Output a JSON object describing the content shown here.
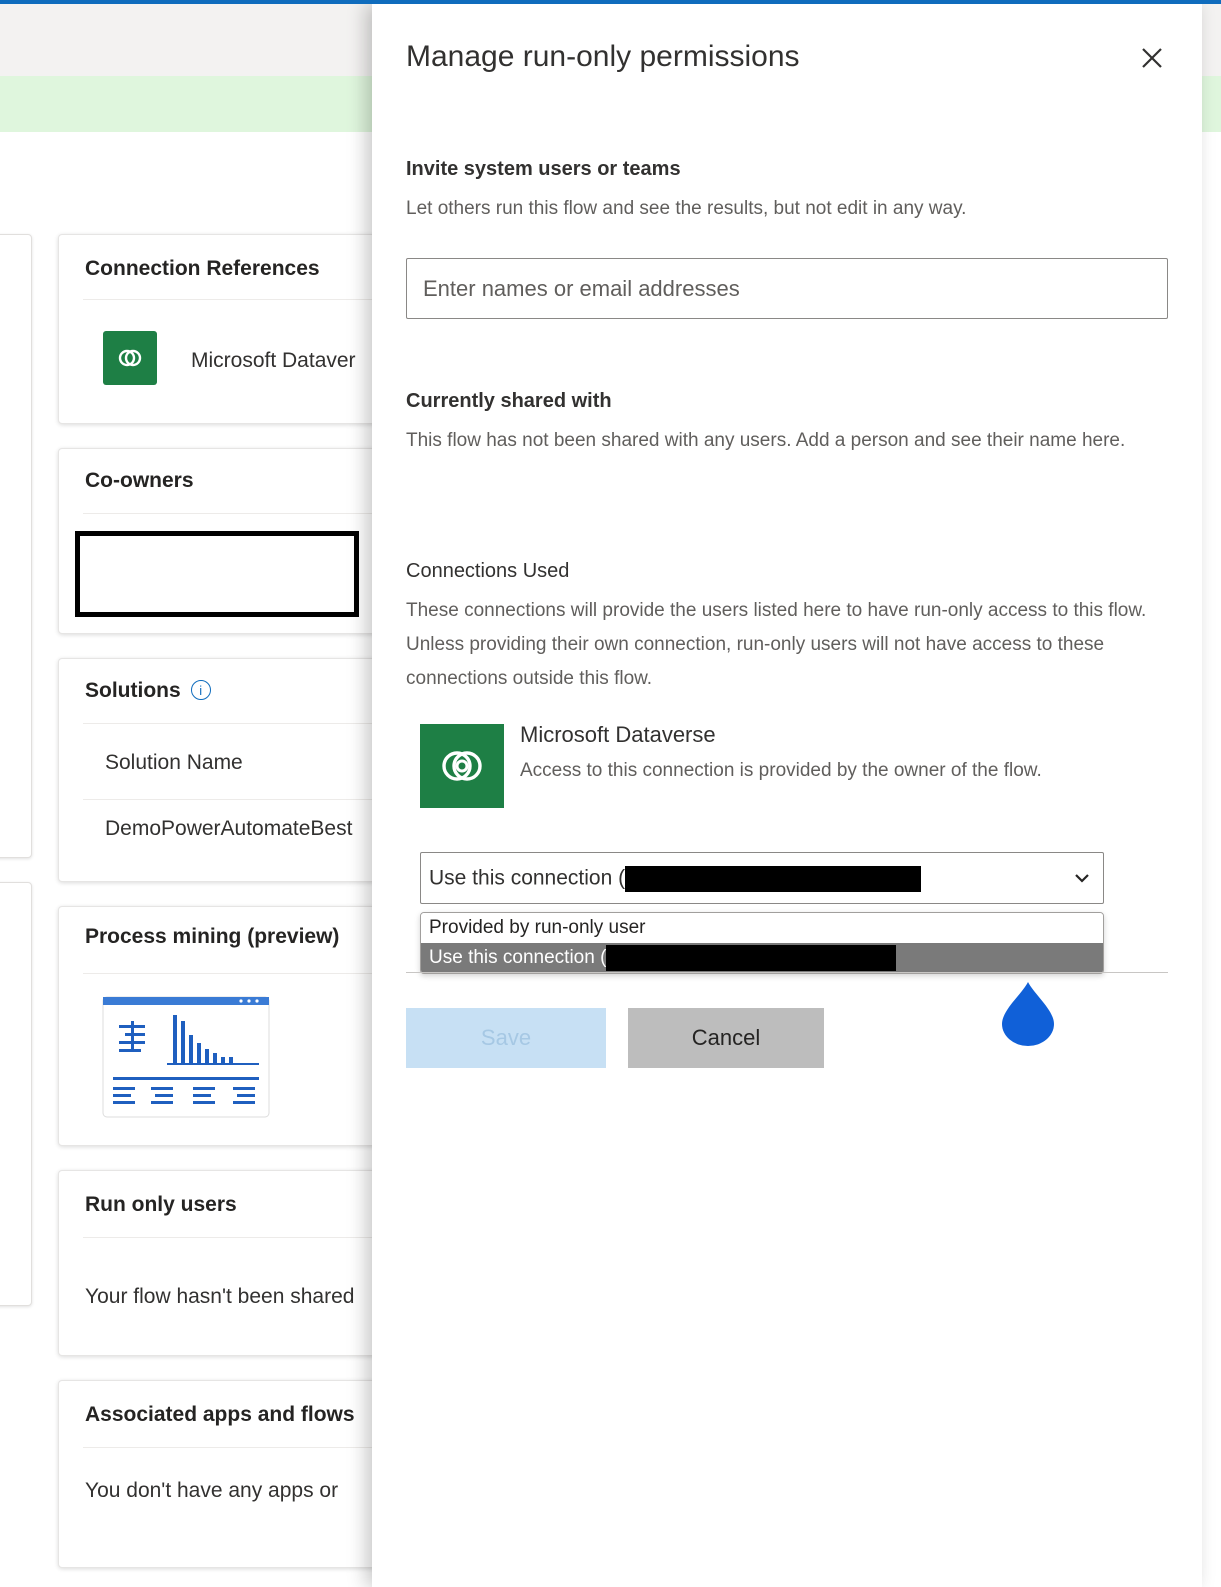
{
  "background": {
    "cards": {
      "connection_references": {
        "title": "Connection References",
        "item_label": "Microsoft Dataver"
      },
      "co_owners": {
        "title": "Co-owners"
      },
      "solutions": {
        "title": "Solutions",
        "column_header": "Solution Name",
        "row_value": "DemoPowerAutomateBest"
      },
      "process_mining": {
        "title": "Process mining (preview)"
      },
      "run_only_users": {
        "title": "Run only users",
        "empty_text": "Your flow hasn't been shared"
      },
      "associated": {
        "title": "Associated apps and flows",
        "empty_text": "You don't have any apps or"
      }
    }
  },
  "panel": {
    "title": "Manage run-only permissions",
    "invite": {
      "heading": "Invite system users or teams",
      "description": "Let others run this flow and see the results, but not edit in any way.",
      "placeholder": "Enter names or email addresses"
    },
    "shared": {
      "heading": "Currently shared with",
      "description": "This flow has not been shared with any users. Add a person and see their name here."
    },
    "connections": {
      "heading": "Connections Used",
      "description": "These connections will provide the users listed here to have run-only access to this flow. Unless providing their own connection, run-only users will not have access to these connections outside this flow.",
      "item": {
        "name": "Microsoft Dataverse",
        "description": "Access to this connection is provided by the owner of the flow.",
        "icon": "dataverse-icon",
        "brand_color": "#1e7f45"
      },
      "select_value": "Use this connection (",
      "options": [
        "Provided by run-only user",
        "Use this connection ("
      ]
    },
    "buttons": {
      "save": "Save",
      "cancel": "Cancel"
    }
  },
  "colors": {
    "accent": "#0f6cbd",
    "banner": "#dff6dd"
  }
}
